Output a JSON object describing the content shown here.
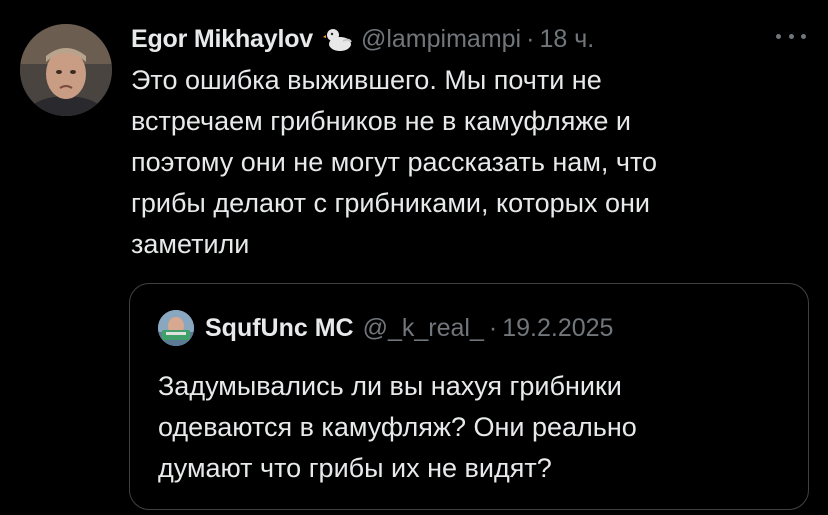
{
  "tweet": {
    "author": {
      "name": "Egor Mikhaylov",
      "emoji": "duck-emoji",
      "handle": "@lampimampi",
      "time": "18 ч."
    },
    "separator": "·",
    "more_icon": "ellipsis-icon",
    "text": "Это ошибка выжившего. Мы почти не\nвстречаем грибников не в камуфляже и\nпоэтому они не могут рассказать нам, что\nгрибы делают с грибниками, которых они\nзаметили"
  },
  "quote": {
    "author": {
      "name": "SqufUnc MC",
      "handle": "@_k_real_",
      "date": "19.2.2025"
    },
    "separator": "·",
    "text": "Задумывались ли вы нахуя грибники\nодеваются в камуфляж? Они реально\nдумают что грибы их не видят?"
  },
  "colors": {
    "background": "#000000",
    "primary_text": "#e7e9ea",
    "secondary_text": "#71767b",
    "border": "#3e4144"
  }
}
